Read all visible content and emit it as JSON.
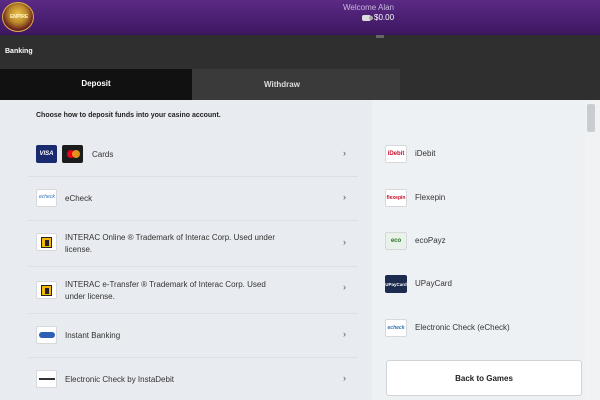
{
  "header": {
    "logo_text": "EMPIRE",
    "welcome": "Welcome Alan",
    "balance": "$0.00",
    "wallet_icon": "wallet-icon"
  },
  "page": {
    "title": "Banking"
  },
  "tabs": [
    {
      "label": "Deposit",
      "active": true
    },
    {
      "label": "Withdraw",
      "active": false
    }
  ],
  "instruction": "Choose how to deposit funds into your casino account.",
  "left_methods": [
    {
      "label": "Cards",
      "icons": [
        "VISA",
        "mastercard"
      ]
    },
    {
      "label": "eCheck",
      "icon": "echeck"
    },
    {
      "label": "INTERAC Online ® Trademark of Interac Corp. Used under license.",
      "icon": "interac"
    },
    {
      "label": "INTERAC e-Transfer ® Trademark of Interac Corp. Used under license.",
      "icon": "interac"
    },
    {
      "label": "Instant Banking",
      "icon": "instant-banking"
    },
    {
      "label": "Electronic Check by InstaDebit",
      "icon": "instadebit"
    }
  ],
  "right_methods": [
    {
      "label": "iDebit",
      "icon_text": "iDebit"
    },
    {
      "label": "Flexepin",
      "icon_text": "flexepin"
    },
    {
      "label": "ecoPayz",
      "icon_text": "eco"
    },
    {
      "label": "UPayCard",
      "icon_text": "UPayCard"
    },
    {
      "label": "Electronic Check (eCheck)",
      "icon_text": "echeck"
    }
  ],
  "chevron": "›",
  "back_button": "Back to Games",
  "colors": {
    "header_top": "#5b2a85",
    "header_bottom": "#3c1760",
    "active_tab": "#111111",
    "content_bg": "#e8ebef"
  }
}
